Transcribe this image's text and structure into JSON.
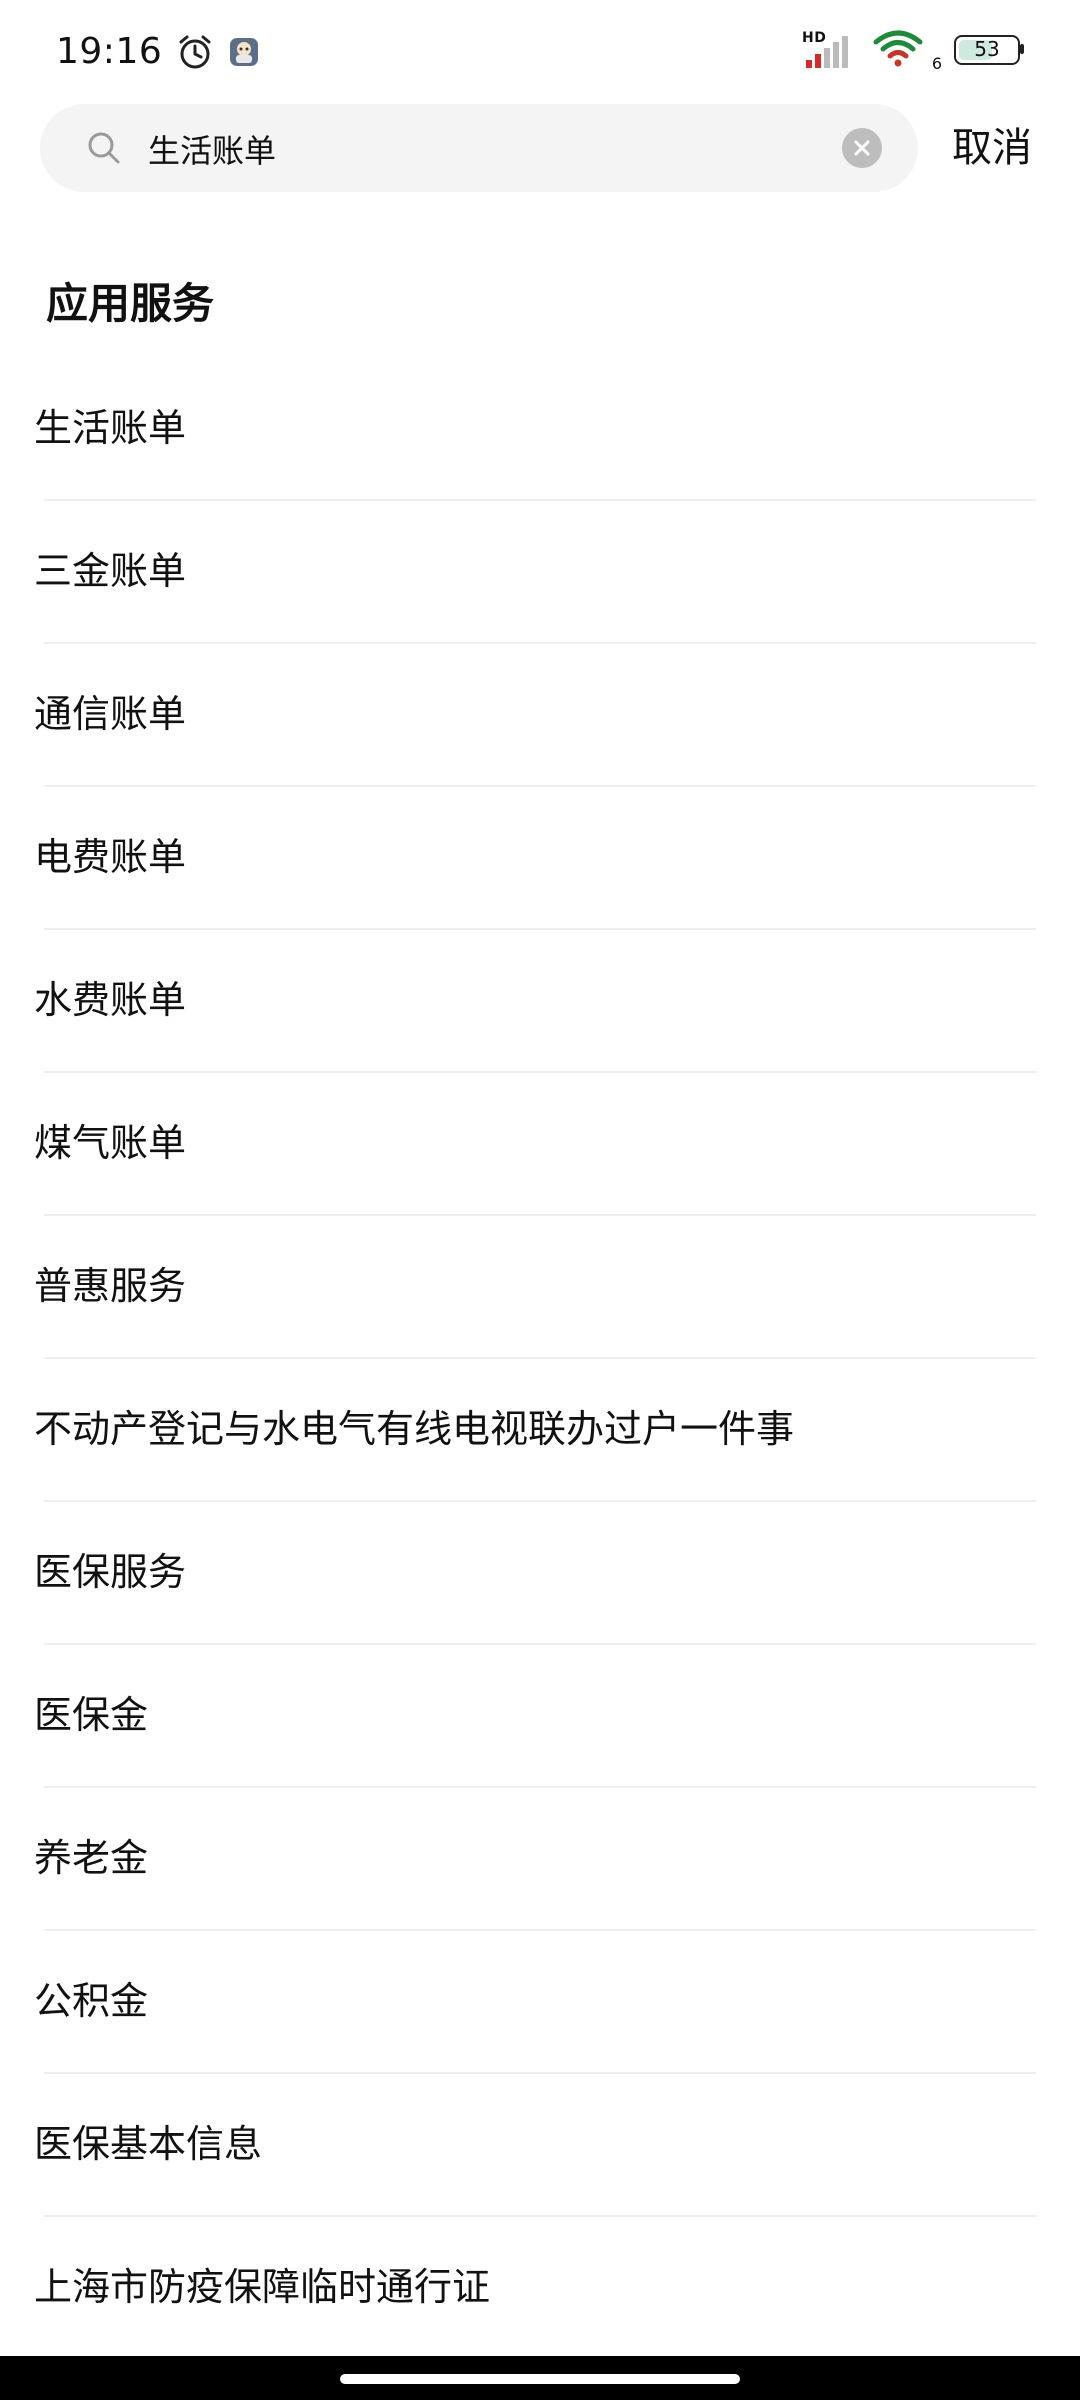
{
  "status_bar": {
    "time": "19:16",
    "hd_label": "HD",
    "wifi_label": "6",
    "battery_level": "53"
  },
  "search": {
    "query": "生活账单",
    "cancel_label": "取消"
  },
  "section": {
    "title": "应用服务"
  },
  "results": [
    {
      "label": "生活账单"
    },
    {
      "label": "三金账单"
    },
    {
      "label": "通信账单"
    },
    {
      "label": "电费账单"
    },
    {
      "label": "水费账单"
    },
    {
      "label": "煤气账单"
    },
    {
      "label": "普惠服务"
    },
    {
      "label": "不动产登记与水电气有线电视联办过户一件事"
    },
    {
      "label": "医保服务"
    },
    {
      "label": "医保金"
    },
    {
      "label": "养老金"
    },
    {
      "label": "公积金"
    },
    {
      "label": "医保基本信息"
    },
    {
      "label": "上海市防疫保障临时通行证"
    }
  ]
}
